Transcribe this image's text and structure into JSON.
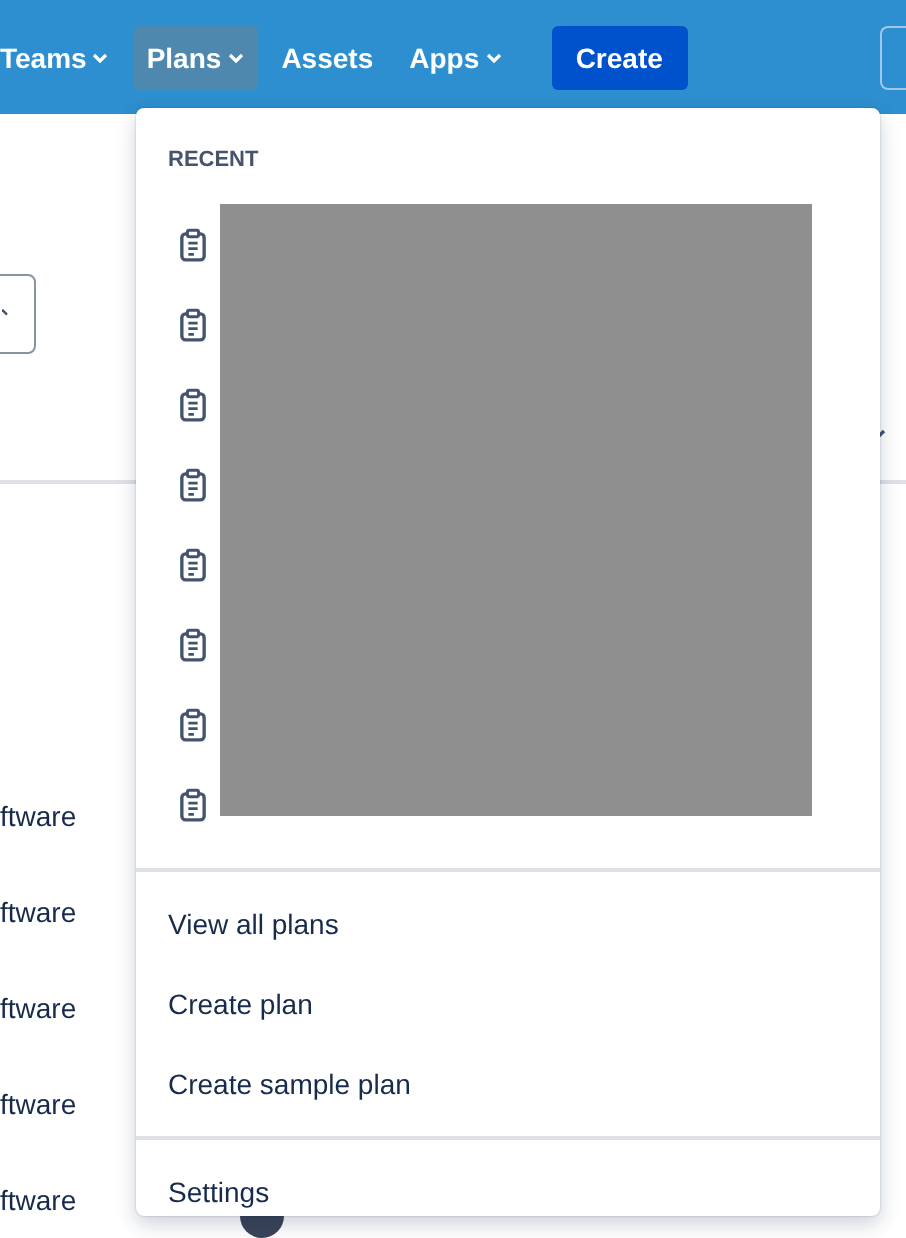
{
  "nav": [
    {
      "label": "Teams",
      "caret": true,
      "selected": false
    },
    {
      "label": "Plans",
      "caret": true,
      "selected": true
    },
    {
      "label": "Assets",
      "caret": false,
      "selected": false
    },
    {
      "label": "Apps",
      "caret": true,
      "selected": false
    }
  ],
  "create_button": "Create",
  "background_rows": [
    "ftware",
    "ftware",
    "ftware",
    "ftware",
    "ftware"
  ],
  "menu": {
    "heading": "RECENT",
    "recent_items": [
      {
        "kind": "plan"
      },
      {
        "kind": "plan"
      },
      {
        "kind": "plan"
      },
      {
        "kind": "plan"
      },
      {
        "kind": "plan"
      },
      {
        "kind": "plan"
      },
      {
        "kind": "plan"
      },
      {
        "kind": "plan"
      }
    ],
    "actions": [
      "View all plans",
      "Create plan",
      "Create sample plan"
    ],
    "footer": [
      "Settings"
    ]
  }
}
